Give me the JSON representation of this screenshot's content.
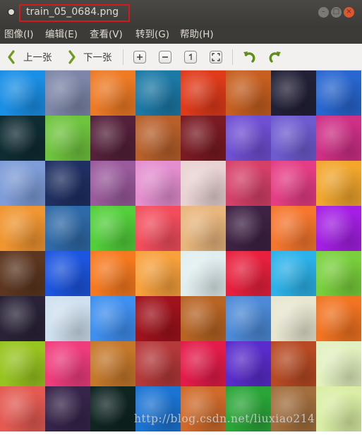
{
  "window": {
    "title": "train_05_0684.png",
    "controls": {
      "minimize": "–",
      "maximize": "□",
      "close": "×"
    }
  },
  "menu": [
    "图像(I)",
    "编辑(E)",
    "查看(V)",
    "转到(G)",
    "帮助(H)"
  ],
  "toolbar": {
    "prev_label": "上一张",
    "next_label": "下一张",
    "icons": [
      "zoom-in-icon",
      "zoom-out-icon",
      "normal-size-icon",
      "best-fit-icon",
      "rotate-left-icon",
      "rotate-right-icon"
    ]
  },
  "image": {
    "grid_columns": 8,
    "grid_rows_visible": 8,
    "tiles": [
      [
        "#1a8fe6",
        "#7d86a8",
        "#ee7a24",
        "#1c79a6",
        "#df3a1a",
        "#c65f20",
        "#222036",
        "#2866d0"
      ],
      [
        "#0f2c33",
        "#6fc43e",
        "#54203a",
        "#b8602a",
        "#7a1a22",
        "#6f4fd4",
        "#6e5bd0",
        "#cf2f85"
      ],
      [
        "#7e9cd8",
        "#1f2f62",
        "#9a5a9c",
        "#e48ecf",
        "#e9d2d2",
        "#d64068",
        "#e53d85",
        "#f2a62c"
      ],
      [
        "#f09530",
        "#2f6aa8",
        "#52cf3a",
        "#f34d5d",
        "#e8b57c",
        "#3e2244",
        "#f6762d",
        "#a41fe4"
      ],
      [
        "#5c3620",
        "#1c55e0",
        "#f7791f",
        "#f7a03c",
        "#e1eef0",
        "#e8203e",
        "#2bb2ea",
        "#79d03c"
      ],
      [
        "#2a2338",
        "#cfe0ef",
        "#3f8ff0",
        "#a0121c",
        "#b86424",
        "#4c8ad8",
        "#e7e6d0",
        "#f27321"
      ],
      [
        "#98c41f",
        "#ef3c7d",
        "#c5782a",
        "#b5383a",
        "#e31b4a",
        "#5a2ccc",
        "#b74a23",
        "#e2f0bf"
      ],
      [
        "#e45a52",
        "#36244a",
        "#0f2522",
        "#1b74d4",
        "#cf6a2a",
        "#2aa638",
        "#a26e3d",
        "#d9eea4"
      ]
    ]
  },
  "watermark": "http://blog.csdn.net/liuxiao214"
}
